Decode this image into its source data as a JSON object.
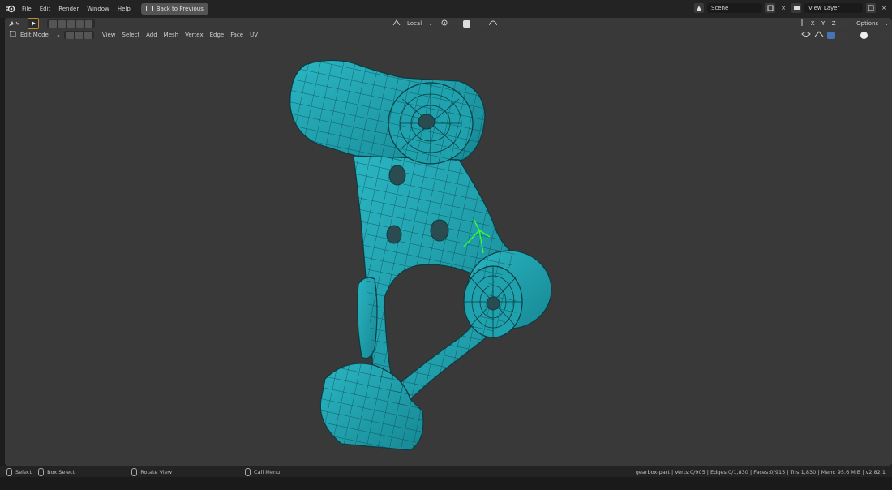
{
  "menu": [
    "File",
    "Edit",
    "Render",
    "Window",
    "Help"
  ],
  "back_button": "Back to Previous",
  "scene": {
    "name": "Scene",
    "view_layer": "View Layer"
  },
  "toolbar": {
    "mode": "Edit Mode",
    "menus": [
      "View",
      "Select",
      "Add",
      "Mesh",
      "Vertex",
      "Edge",
      "Face",
      "UV"
    ],
    "pivot": "Local",
    "axes": [
      "X",
      "Y",
      "Z"
    ],
    "options": "Options"
  },
  "status": {
    "select": "Select",
    "box_select": "Box Select",
    "rotate_view": "Rotate View",
    "call_menu": "Call Menu",
    "stats": "gearbox-part | Verts:0/905 | Edges:0/1,830 | Faces:0/915 | Tris:1,830 | Mem: 95.6 MiB | v2.82.1"
  },
  "colors": {
    "mesh": "#1a9eab",
    "viewport": "#393939",
    "accent": "#4772b3",
    "selection": "#33ff33"
  }
}
